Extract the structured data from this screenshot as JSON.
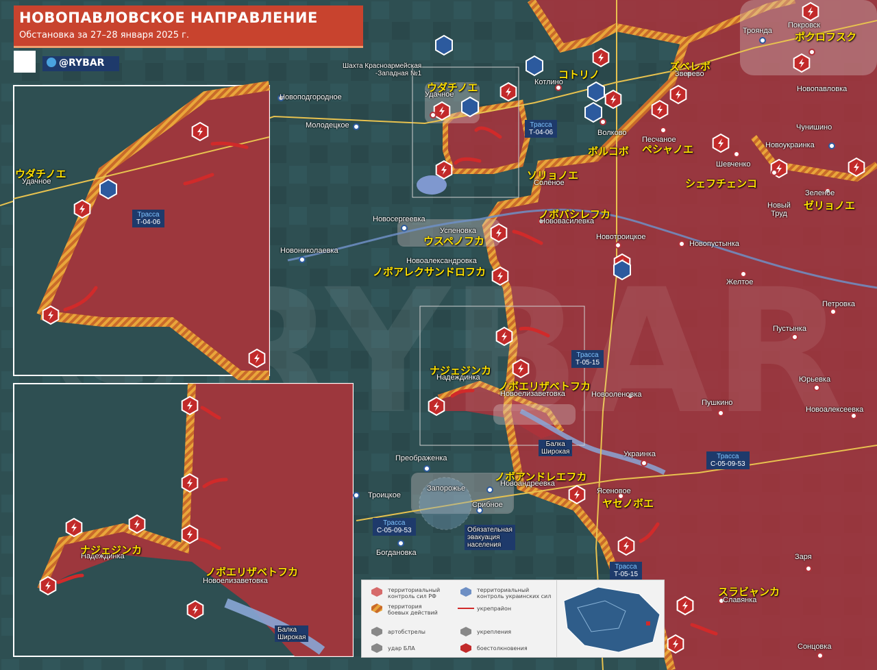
{
  "header": {
    "title": "НОВОПАВЛОВСКОЕ НАПРАВЛЕНИЕ",
    "subtitle": "Обстановка за 27–28 января 2025 г.",
    "brand": "@RYBAR",
    "watermark": "©RYBAR"
  },
  "places_ru": {
    "pokrovsk": "Покровск",
    "troyanda": "Троянда",
    "shakhta": "Шахта Красноармейская\n-Западная №1",
    "kotlino": "Котлино",
    "udachnoe": "Удачное",
    "zverevo": "Зверево",
    "novopavlovka": "Новопавловка",
    "novopodgorodnoe": "Новоподгородное",
    "molodetskoe": "Молодецкое",
    "volkovo": "Волково",
    "peschanoe": "Песчаное",
    "chunishino": "Чунишино",
    "novoukrainka": "Новоукраинка",
    "shevchenko": "Шевченко",
    "solenoe": "Солёное",
    "zelenoe": "Зеленое",
    "novyi_trud": "Новый\nТруд",
    "novosergeevka": "Новосергеевка",
    "uspenovka": "Успеновка",
    "novovasilevka": "Нововасилевка",
    "novotroitskoe": "Новотроицкое",
    "novopustynka": "Новопустынка",
    "novonikolaevka": "Новониколаевка",
    "novoaleksandrovka": "Новоалександровка",
    "zheltoe": "Желтое",
    "petrovka": "Петровка",
    "pustynka": "Пустынка",
    "nadezhdinka": "Надеждинка",
    "novoelizavetovka": "Новоелизаветовка",
    "novoolenovka": "Новооленовка",
    "yurevka": "Юрьевка",
    "pushkino": "Пушкино",
    "novoalekseevka": "Новоалексеевка",
    "balka": "Балка\nШирокая",
    "ukrainka": "Украинка",
    "preobrazhenka": "Преображенка",
    "troitskoe": "Троицкое",
    "zaporozhe": "Запорожье",
    "novoandreevka": "Новоандреевка",
    "yasenovoe": "Ясеновое",
    "sribnoe": "Срибное",
    "bogdanovka": "Богдановка",
    "zarya": "Заря",
    "slavyanka": "Славянка",
    "sontsovka": "Сонцовка",
    "evac": "Обязательная\nэвакуация\nнаселения"
  },
  "places_jp": {
    "pokrovsk": "ポクロフスク",
    "kotlino": "コトリノ",
    "zverevo": "ズベレボ",
    "udachnoe": "ウダチノエ",
    "volkovo": "ボルコボ",
    "peschanoe": "ペシャノエ",
    "shevchenko": "シェフチェンコ",
    "solenoe": "ソリョノエ",
    "zelenoe": "ゼリョノエ",
    "novovasilevka": "ノボバシレフカ",
    "uspenovka": "ウスペノフカ",
    "novoaleksandrovka": "ノボアレクサンドロフカ",
    "nadezhdinka": "ナジェジンカ",
    "novoelizavetovka": "ノボエリザベトフカ",
    "novoandreevka": "ノボアンドレエフカ",
    "yasenovoe": "ヤセノボエ",
    "slavyanka": "スラビャンカ"
  },
  "roads": {
    "label": "Трасса",
    "t0406": "Т-04-06",
    "t0515": "Т-05-15",
    "c050953": "С-05-09-53"
  },
  "legend": {
    "ru_control": "территориальный\nконтроль сил РФ",
    "ua_control": "территориальный\nконтроль украинских сил",
    "combat": "территория\nбоевых действий",
    "fortified": "укрепрайон",
    "artillery": "артобстрелы",
    "fortifications": "укрепления",
    "drone": "удар БЛА",
    "clashes": "боестолкновения"
  },
  "colors": {
    "ru_zone": "#b0323a",
    "combat_stripe": "#e59a33",
    "ua_icon": "#2c5a9e",
    "map_base": "#2b4a4e",
    "title_bg": "#c8432e",
    "road_badge": "#1e3a6b"
  }
}
